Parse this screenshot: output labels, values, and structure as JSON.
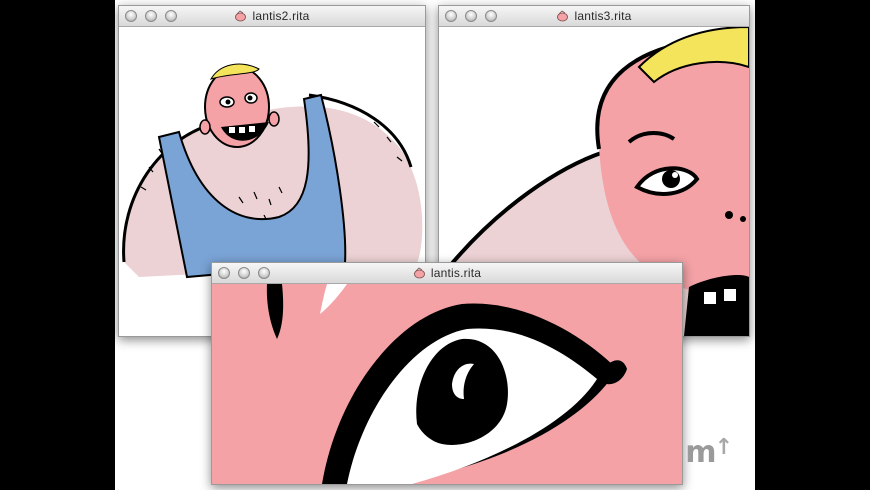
{
  "windows": [
    {
      "title": "lantis2.rita",
      "doc_icon": "rita-document-icon"
    },
    {
      "title": "lantis3.rita",
      "doc_icon": "rita-document-icon"
    },
    {
      "title": "lantis.rita",
      "doc_icon": "rita-document-icon"
    }
  ],
  "watermark": {
    "text": "m",
    "arrow": "↑"
  },
  "colors": {
    "skin_pink": "#f4a2a6",
    "body_light_pink": "#ecd2d4",
    "tank_blue": "#7aa3d6",
    "hair_yellow": "#f4e45c",
    "ink": "#000000"
  }
}
